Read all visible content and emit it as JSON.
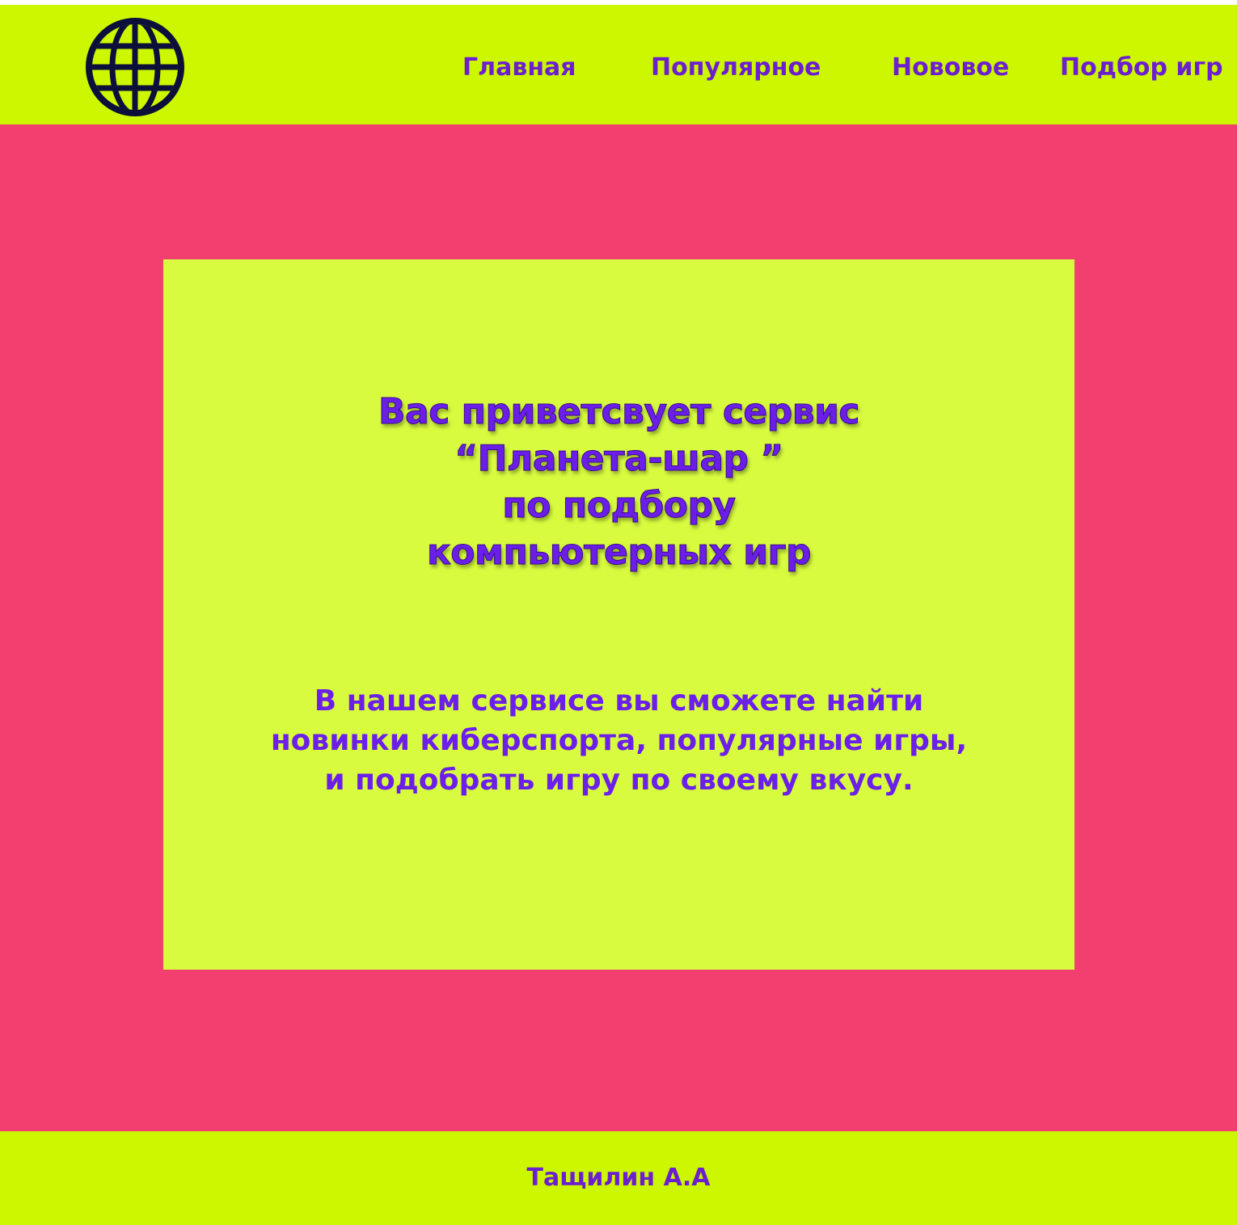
{
  "header": {
    "logo_icon": "globe-icon",
    "nav": [
      {
        "label": "Главная"
      },
      {
        "label": "Популярное"
      },
      {
        "label": "Нововое"
      },
      {
        "label": "Подбор игр"
      }
    ]
  },
  "hero": {
    "headline_lines": [
      "Вас приветсвует сервис",
      "“Планета-шар ”",
      "по подбору",
      "компьютерных игр"
    ],
    "description_lines": [
      "В нашем сервисе вы сможете найти",
      "новинки киберспорта, популярные игры,",
      "и подобрать игру по своему вкусу."
    ]
  },
  "footer": {
    "author": "Тащилин А.А"
  },
  "colors": {
    "header_bg": "#ccf700",
    "main_bg": "#f13f6f",
    "card_bg": "#d8fb3f",
    "text_purple": "#6b1fcf",
    "logo_dark": "#0b0f3a"
  }
}
